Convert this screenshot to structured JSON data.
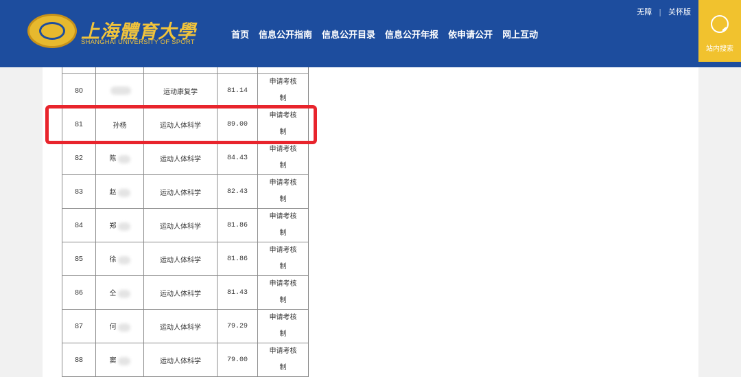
{
  "header": {
    "logo_cn": "上海體育大學",
    "logo_en": "SHANGHAI UNIVERSITY OF SPORT",
    "nav": [
      "首页",
      "信息公开指南",
      "信息公开目录",
      "信息公开年报",
      "依申请公开",
      "网上互动"
    ],
    "util": {
      "accessibility": "无障",
      "elder": "关怀版"
    },
    "search_label": "站内搜索"
  },
  "table": {
    "rows": [
      {
        "no": "80",
        "name": "",
        "major": "运动康复学",
        "score": "81.14",
        "method": [
          "申请考核",
          "制"
        ]
      },
      {
        "no": "81",
        "name": "孙杨",
        "major": "运动人体科学",
        "score": "89.00",
        "method": [
          "申请考核",
          "制"
        ]
      },
      {
        "no": "82",
        "name": "陈",
        "major": "运动人体科学",
        "score": "84.43",
        "method": [
          "申请考核",
          "制"
        ]
      },
      {
        "no": "83",
        "name": "赵",
        "major": "运动人体科学",
        "score": "82.43",
        "method": [
          "申请考核",
          "制"
        ]
      },
      {
        "no": "84",
        "name": "郑",
        "major": "运动人体科学",
        "score": "81.86",
        "method": [
          "申请考核",
          "制"
        ]
      },
      {
        "no": "85",
        "name": "徐",
        "major": "运动人体科学",
        "score": "81.86",
        "method": [
          "申请考核",
          "制"
        ]
      },
      {
        "no": "86",
        "name": "仝",
        "major": "运动人体科学",
        "score": "81.43",
        "method": [
          "申请考核",
          "制"
        ]
      },
      {
        "no": "87",
        "name": "何",
        "major": "运动人体科学",
        "score": "79.29",
        "method": [
          "申请考核",
          "制"
        ]
      },
      {
        "no": "88",
        "name": "窦",
        "major": "运动人体科学",
        "score": "79.00",
        "method": [
          "申请考核",
          "制"
        ]
      }
    ]
  },
  "colors": {
    "header_bg": "#1d4d9e",
    "accent_gold": "#f1c22e",
    "highlight_red": "#e8242c"
  }
}
